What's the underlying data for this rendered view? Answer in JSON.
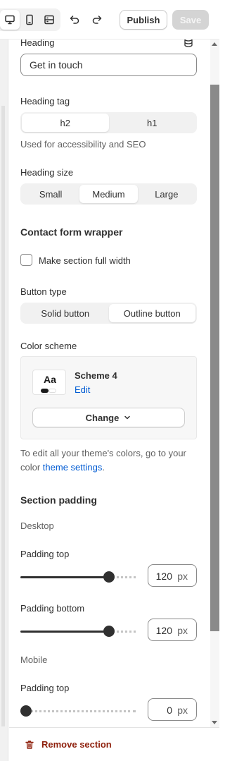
{
  "toolbar": {
    "publish_label": "Publish",
    "save_label": "Save"
  },
  "fields": {
    "heading_label": "Heading",
    "heading_value": "Get in touch",
    "heading_tag_label": "Heading tag",
    "heading_tag_options": [
      "h2",
      "h1"
    ],
    "heading_tag_selected": "h2",
    "heading_tag_help": "Used for accessibility and SEO",
    "heading_size_label": "Heading size",
    "heading_size_options": [
      "Small",
      "Medium",
      "Large"
    ],
    "heading_size_selected": "Medium"
  },
  "contact_form": {
    "section_title": "Contact form wrapper",
    "full_width_label": "Make section full width",
    "full_width_checked": false,
    "button_type_label": "Button type",
    "button_type_options": [
      "Solid button",
      "Outline button"
    ],
    "button_type_selected": "Outline button"
  },
  "color_scheme": {
    "label": "Color scheme",
    "swatch_text": "Aa",
    "name": "Scheme 4",
    "edit_label": "Edit",
    "change_label": "Change",
    "help_prefix": "To edit all your theme's colors, go to your color ",
    "help_link": "theme settings",
    "help_suffix": "."
  },
  "padding": {
    "section_title": "Section padding",
    "desktop_label": "Desktop",
    "mobile_label": "Mobile",
    "desktop_top_label": "Padding top",
    "desktop_top_value": "120",
    "desktop_top_fraction": 0.8,
    "desktop_bottom_label": "Padding bottom",
    "desktop_bottom_value": "120",
    "desktop_bottom_fraction": 0.8,
    "mobile_top_label": "Padding top",
    "mobile_top_value": "0",
    "mobile_top_fraction": 0.0,
    "unit": "px"
  },
  "footer": {
    "remove_label": "Remove section"
  },
  "colors": {
    "link": "#005bd3",
    "danger": "#8e1f0b",
    "save_disabled": "#d4d4d4"
  }
}
